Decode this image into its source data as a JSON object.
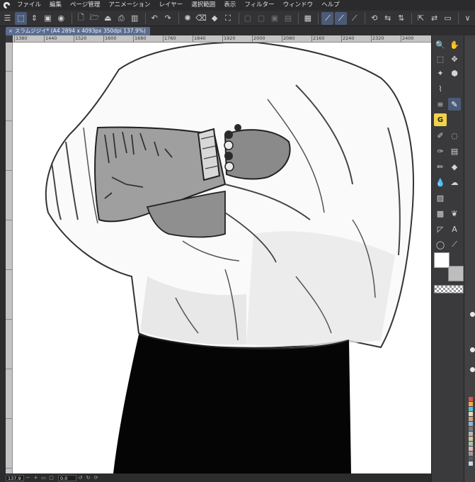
{
  "menubar": {
    "logo_icon": "clip-studio-icon",
    "items": [
      "ファイル",
      "編集",
      "ページ管理",
      "アニメーション",
      "レイヤー",
      "選択範囲",
      "表示",
      "フィルター",
      "ウィンドウ",
      "ヘルプ"
    ]
  },
  "toolbar": {
    "chevron_label": "∨"
  },
  "document": {
    "tab_label": "スラムジジイ* (A4 2894 x 4093px 350dpi 137.9%)",
    "close_glyph": "×"
  },
  "ruler": {
    "top_labels": [
      "1380",
      "1440",
      "1520",
      "1600",
      "1680",
      "1760",
      "1840",
      "1920",
      "2000",
      "2080",
      "2160",
      "2240",
      "2320",
      "2400"
    ]
  },
  "status": {
    "zoom_value": "137.9",
    "rotation_value": "0.0"
  },
  "colors": {
    "accent": "#4b5b77",
    "tab_active": "#5a6d90",
    "panel_bg": "#3a3a3c",
    "menubar_bg": "#2b2b2d",
    "foreground_swatch": "#ffffff",
    "background_swatch": "#bdbdbd",
    "g_badge": "#f2d24a"
  }
}
